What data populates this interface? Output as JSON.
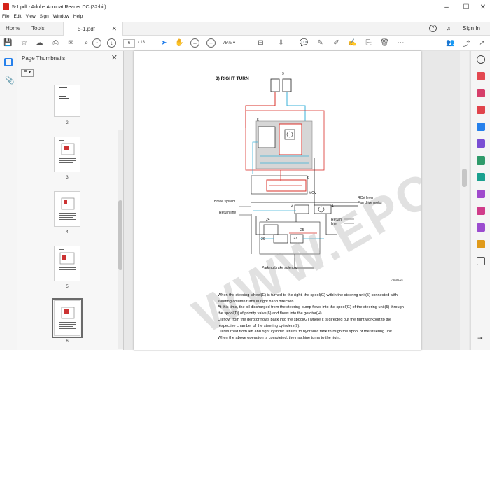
{
  "window": {
    "title": "5-1.pdf - Adobe Acrobat Reader DC (32-bit)",
    "minimize": "–",
    "maximize": "☐",
    "close": "✕"
  },
  "menu": [
    "File",
    "Edit",
    "View",
    "Sign",
    "Window",
    "Help"
  ],
  "tabs": {
    "home": "Home",
    "tools": "Tools",
    "doc": "5-1.pdf",
    "doc_close": "✕",
    "help": "?",
    "bell": "🔔",
    "signin": "Sign In"
  },
  "toolbar": {
    "page_current": "6",
    "page_total": "/ 13",
    "zoom": "75%"
  },
  "thumbnails": {
    "header": "Page Thumbnails",
    "close": "✕",
    "options": "☰ ▾",
    "pages": [
      {
        "label": "2"
      },
      {
        "label": "3"
      },
      {
        "label": "4"
      },
      {
        "label": "5"
      },
      {
        "label": "6",
        "selected": true
      }
    ]
  },
  "document": {
    "watermark": "WWW.EPCD-PO.COM",
    "section_title": "3) RIGHT TURN",
    "diagram_labels": {
      "mcv": "MCV",
      "brake_system": "Brake system",
      "return_line_left": "Return line",
      "return_line_right": "Return line",
      "rcv_lever": "RCV lever",
      "fan_drive_motor": "Fan drive motor",
      "parking_brake": "Parking brake solenoid",
      "n9": "9",
      "n5": "5",
      "n6": "6",
      "n2": "2",
      "n1": "1",
      "n24": "24",
      "n26": "26",
      "n27": "27",
      "n25": "25",
      "figid": "7303SD24"
    },
    "paragraph": [
      "When the steering wheel(E) is turned to the right, the spool(G) within the steering unit(5) connected with steering column turns in right hand direction.",
      "At this time, the oil discharged from the steering pump flows into the spool(G) of the steering unit(5) through the spool(D) of priority valve(6) and flows into the gerotor(H).",
      "Oil flow from the gerotor flows back into the spool(G) where it is directed out the right workport to the respective chamber of the steering cylinders(9).",
      "Oil returned from left and right cylinder returns to hydraulic tank through the spool of the steering unit.",
      "When the above operation is completed, the machine turns to the right."
    ]
  },
  "colors": {
    "accent_red": "#d4221a",
    "accent_blue": "#2680eb",
    "circuit_red": "#d9302a",
    "circuit_blue": "#3ab0d8"
  }
}
